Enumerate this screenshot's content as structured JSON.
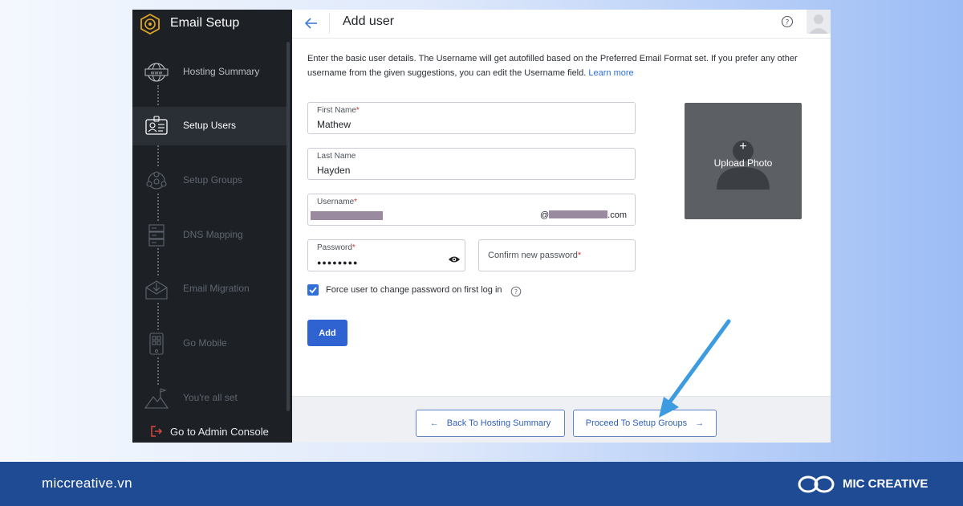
{
  "app": {
    "title": "Email Setup"
  },
  "sidebar": {
    "steps": [
      {
        "label": "Hosting Summary",
        "icon": "globe-www-icon",
        "state": "done"
      },
      {
        "label": "Setup Users",
        "icon": "user-card-icon",
        "state": "active"
      },
      {
        "label": "Setup Groups",
        "icon": "groups-icon",
        "state": "pending"
      },
      {
        "label": "DNS Mapping",
        "icon": "server-icon",
        "state": "pending"
      },
      {
        "label": "Email Migration",
        "icon": "envelope-download-icon",
        "state": "pending"
      },
      {
        "label": "Go Mobile",
        "icon": "mobile-icon",
        "state": "pending"
      },
      {
        "label": "You're all set",
        "icon": "mountain-flag-icon",
        "state": "pending"
      }
    ],
    "footer_label": "Go to Admin Console"
  },
  "header": {
    "title": "Add user"
  },
  "intro": {
    "text": "Enter the basic user details. The Username will get autofilled based on the Preferred Email Format set. If you prefer any other username from the given suggestions, you can edit the Username field.",
    "link": "Learn more"
  },
  "form": {
    "first_name": {
      "label": "First Name",
      "required_mark": "*",
      "value": "Mathew"
    },
    "last_name": {
      "label": "Last Name",
      "value": "Hayden"
    },
    "username": {
      "label": "Username",
      "required_mark": "*",
      "domain_prefix": "@",
      "domain_suffix": ".com"
    },
    "password": {
      "label": "Password",
      "required_mark": "*",
      "value": "●●●●●●●●"
    },
    "confirm_password": {
      "placeholder": "Confirm new password",
      "required_mark": "*"
    },
    "force_change": {
      "label": "Force user to change password on first log in",
      "checked": true
    },
    "add_button": "Add"
  },
  "upload": {
    "plus": "+",
    "label": "Upload Photo"
  },
  "footer": {
    "back_button": "Back To Hosting Summary",
    "proceed_button": "Proceed To Setup Groups",
    "back_arrow": "←",
    "next_arrow": "→"
  },
  "brand": {
    "url": "miccreative.vn",
    "name": "MIC CREATIVE"
  },
  "colors": {
    "accent": "#2f63d1",
    "sidebar": "#1d2126",
    "brand_bar": "#1f4a94",
    "annotation_arrow": "#3d9be0"
  }
}
